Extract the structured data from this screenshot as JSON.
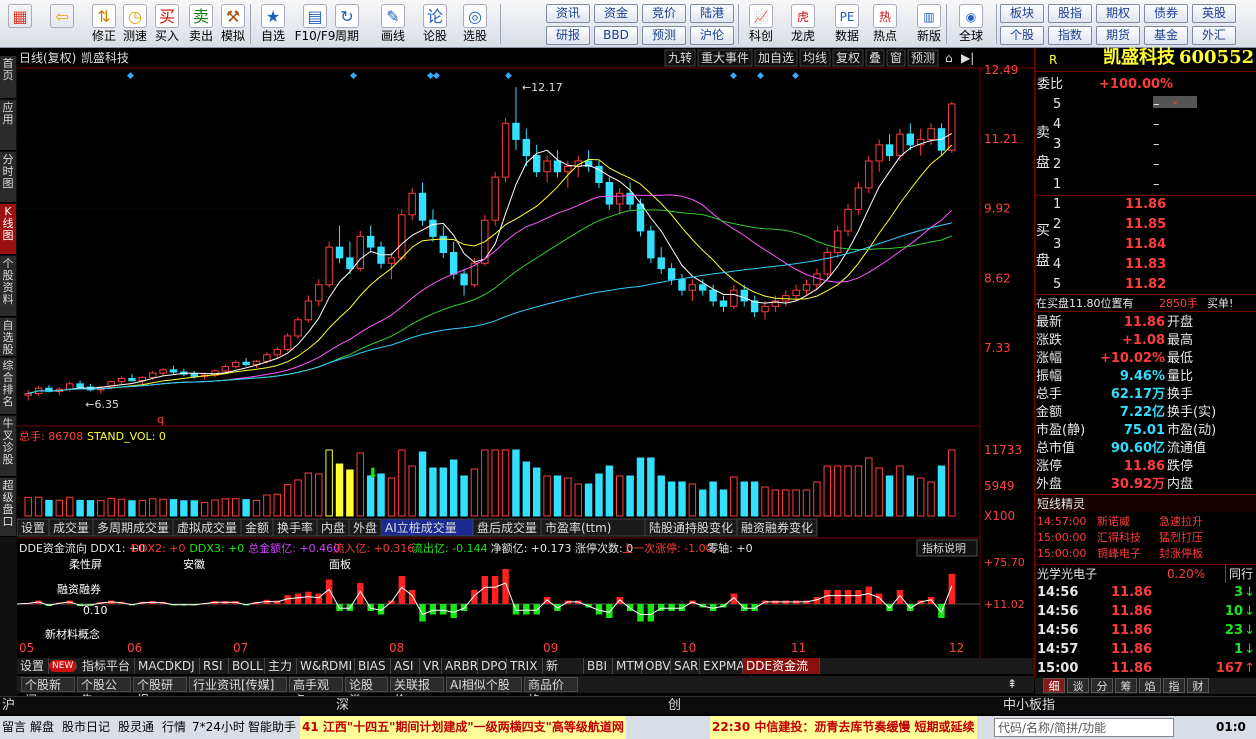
{
  "toolbar": {
    "buttons": [
      {
        "label": "",
        "icon": "windows-icon",
        "glyph": "▦",
        "color": "#e03a2a"
      },
      {
        "label": "",
        "icon": "back-arrow-icon",
        "glyph": "⇦",
        "color": "#f0a000"
      },
      {
        "label": "修正",
        "icon": "up-down-arrow-icon",
        "glyph": "⇅",
        "color": "#d08000"
      },
      {
        "label": "测速",
        "icon": "clock-icon",
        "glyph": "◷",
        "color": "#e0a000"
      },
      {
        "label": "买入",
        "icon": "buy-icon",
        "glyph": "买",
        "color": "#d01010"
      },
      {
        "label": "卖出",
        "icon": "sell-icon",
        "glyph": "卖",
        "color": "#108010"
      },
      {
        "label": "模拟",
        "icon": "hammer-icon",
        "glyph": "⚒",
        "color": "#a05010"
      },
      {
        "label": "自选",
        "icon": "star-folder-icon",
        "glyph": "★",
        "color": "#2060c0"
      },
      {
        "label": "F10/F9",
        "icon": "f10-icon",
        "glyph": "▤",
        "color": "#2060c0"
      },
      {
        "label": "周期",
        "icon": "cycle-icon",
        "glyph": "↻",
        "color": "#2060c0"
      },
      {
        "label": "画线",
        "icon": "pencil-icon",
        "glyph": "✎",
        "color": "#2060c0"
      },
      {
        "label": "论股",
        "icon": "discuss-icon",
        "glyph": "论",
        "color": "#2060c0"
      },
      {
        "label": "选股",
        "icon": "select-stock-icon",
        "glyph": "◎",
        "color": "#2060c0"
      }
    ],
    "grid_left": [
      "资讯",
      "资金",
      "竞价",
      "陆港",
      "研报",
      "BBD",
      "预测",
      "沪伦"
    ],
    "buttons2": [
      {
        "label": "科创",
        "icon": "sci-chart-icon",
        "glyph": "📈",
        "color": "#2060c0"
      },
      {
        "label": "龙虎",
        "icon": "dragon-tiger-icon",
        "glyph": "虎",
        "color": "#d01010"
      },
      {
        "label": "数据",
        "icon": "pe-icon",
        "glyph": "PE",
        "color": "#2060c0"
      },
      {
        "label": "热点",
        "icon": "hot-icon",
        "glyph": "热",
        "color": "#d01010"
      },
      {
        "label": "新版",
        "icon": "new-version-icon",
        "glyph": "▥",
        "color": "#2060c0"
      },
      {
        "label": "全球",
        "icon": "globe-icon",
        "glyph": "◉",
        "color": "#2060c0"
      }
    ],
    "grid_right": [
      "板块",
      "股指",
      "期权",
      "债券",
      "英股",
      "个股",
      "指数",
      "期货",
      "基金",
      "外汇"
    ]
  },
  "left_nav": [
    "首页",
    "应用",
    "分时图",
    "K线图",
    "个股资料",
    "自选股",
    "综合排名",
    "牛叉诊股",
    "超级盘口"
  ],
  "chart_header": {
    "mode": "日线(复权)",
    "name": "凯盛科技",
    "tools": [
      "九转",
      "重大事件",
      "加自选",
      "均线",
      "复权",
      "叠",
      "窗",
      "预测"
    ]
  },
  "chart_data": {
    "type": "candlestick",
    "y_ticks": [
      "12.49",
      "11.21",
      "9.92",
      "8.62",
      "7.33"
    ],
    "high_label": "12.17",
    "low_label": "6.35",
    "x_months": [
      "05",
      "06",
      "07",
      "08",
      "09",
      "10",
      "11",
      "12"
    ],
    "ohlc": [
      [
        6.45,
        6.55,
        6.35,
        6.48
      ],
      [
        6.48,
        6.62,
        6.44,
        6.58
      ],
      [
        6.58,
        6.64,
        6.5,
        6.52
      ],
      [
        6.52,
        6.6,
        6.45,
        6.56
      ],
      [
        6.56,
        6.7,
        6.52,
        6.66
      ],
      [
        6.66,
        6.72,
        6.58,
        6.6
      ],
      [
        6.6,
        6.66,
        6.52,
        6.55
      ],
      [
        6.55,
        6.62,
        6.48,
        6.6
      ],
      [
        6.6,
        6.72,
        6.56,
        6.7
      ],
      [
        6.7,
        6.8,
        6.64,
        6.76
      ],
      [
        6.76,
        6.84,
        6.7,
        6.72
      ],
      [
        6.72,
        6.8,
        6.66,
        6.78
      ],
      [
        6.78,
        6.9,
        6.74,
        6.86
      ],
      [
        6.86,
        6.96,
        6.8,
        6.92
      ],
      [
        6.92,
        7.0,
        6.84,
        6.88
      ],
      [
        6.88,
        6.94,
        6.8,
        6.84
      ],
      [
        6.84,
        6.9,
        6.76,
        6.8
      ],
      [
        6.8,
        6.86,
        6.74,
        6.82
      ],
      [
        6.82,
        6.92,
        6.78,
        6.9
      ],
      [
        6.9,
        7.02,
        6.86,
        6.98
      ],
      [
        6.98,
        7.1,
        6.94,
        7.06
      ],
      [
        7.06,
        7.14,
        6.98,
        7.02
      ],
      [
        7.02,
        7.1,
        6.96,
        7.08
      ],
      [
        7.08,
        7.25,
        7.04,
        7.2
      ],
      [
        7.2,
        7.35,
        7.12,
        7.3
      ],
      [
        7.3,
        7.6,
        7.26,
        7.55
      ],
      [
        7.55,
        7.9,
        7.5,
        7.85
      ],
      [
        7.85,
        8.3,
        7.8,
        8.2
      ],
      [
        8.2,
        8.6,
        8.1,
        8.5
      ],
      [
        8.5,
        9.3,
        8.45,
        9.2
      ],
      [
        9.2,
        9.6,
        8.9,
        9.0
      ],
      [
        9.0,
        9.3,
        8.7,
        8.8
      ],
      [
        8.8,
        9.5,
        8.75,
        9.4
      ],
      [
        9.4,
        9.6,
        9.1,
        9.2
      ],
      [
        9.2,
        9.3,
        8.8,
        8.9
      ],
      [
        8.9,
        9.1,
        8.6,
        9.0
      ],
      [
        9.0,
        9.9,
        8.95,
        9.8
      ],
      [
        9.8,
        10.3,
        9.7,
        10.2
      ],
      [
        10.2,
        10.4,
        9.6,
        9.7
      ],
      [
        9.7,
        9.9,
        9.3,
        9.4
      ],
      [
        9.4,
        9.6,
        9.0,
        9.1
      ],
      [
        9.1,
        9.3,
        8.6,
        8.7
      ],
      [
        8.7,
        8.8,
        8.3,
        8.5
      ],
      [
        8.5,
        9.0,
        8.45,
        8.9
      ],
      [
        8.9,
        9.8,
        8.85,
        9.7
      ],
      [
        9.7,
        10.6,
        9.6,
        10.5
      ],
      [
        10.5,
        11.6,
        10.4,
        11.5
      ],
      [
        11.5,
        12.17,
        11.0,
        11.2
      ],
      [
        11.2,
        11.4,
        10.7,
        10.9
      ],
      [
        10.9,
        11.1,
        10.5,
        10.6
      ],
      [
        10.6,
        10.9,
        10.4,
        10.8
      ],
      [
        10.8,
        11.0,
        10.5,
        10.6
      ],
      [
        10.6,
        10.8,
        10.3,
        10.7
      ],
      [
        10.7,
        10.9,
        10.5,
        10.8
      ],
      [
        10.8,
        11.0,
        10.6,
        10.7
      ],
      [
        10.7,
        10.8,
        10.3,
        10.4
      ],
      [
        10.4,
        10.5,
        9.9,
        10.0
      ],
      [
        10.0,
        10.3,
        9.8,
        10.2
      ],
      [
        10.2,
        10.4,
        9.9,
        10.0
      ],
      [
        10.0,
        10.1,
        9.4,
        9.5
      ],
      [
        9.5,
        9.6,
        8.9,
        9.0
      ],
      [
        9.0,
        9.2,
        8.7,
        8.8
      ],
      [
        8.8,
        8.9,
        8.5,
        8.6
      ],
      [
        8.6,
        8.7,
        8.3,
        8.4
      ],
      [
        8.4,
        8.6,
        8.2,
        8.5
      ],
      [
        8.5,
        8.6,
        8.3,
        8.4
      ],
      [
        8.4,
        8.5,
        8.1,
        8.2
      ],
      [
        8.2,
        8.3,
        8.0,
        8.1
      ],
      [
        8.1,
        8.5,
        8.05,
        8.4
      ],
      [
        8.4,
        8.5,
        8.1,
        8.2
      ],
      [
        8.2,
        8.3,
        7.9,
        8.0
      ],
      [
        8.0,
        8.2,
        7.85,
        8.1
      ],
      [
        8.1,
        8.3,
        8.0,
        8.2
      ],
      [
        8.2,
        8.4,
        8.1,
        8.3
      ],
      [
        8.3,
        8.5,
        8.2,
        8.4
      ],
      [
        8.4,
        8.6,
        8.3,
        8.5
      ],
      [
        8.5,
        8.8,
        8.4,
        8.7
      ],
      [
        8.7,
        9.2,
        8.6,
        9.1
      ],
      [
        9.1,
        9.6,
        9.0,
        9.5
      ],
      [
        9.5,
        10.0,
        9.4,
        9.9
      ],
      [
        9.9,
        10.4,
        9.8,
        10.3
      ],
      [
        10.3,
        10.9,
        10.2,
        10.8
      ],
      [
        10.8,
        11.2,
        10.6,
        11.1
      ],
      [
        11.1,
        11.3,
        10.8,
        10.9
      ],
      [
        10.9,
        11.4,
        10.8,
        11.3
      ],
      [
        11.3,
        11.5,
        11.0,
        11.1
      ],
      [
        11.1,
        11.4,
        10.9,
        11.2
      ],
      [
        11.2,
        11.5,
        11.1,
        11.4
      ],
      [
        11.4,
        11.5,
        10.9,
        11.0
      ],
      [
        11.0,
        11.9,
        10.95,
        11.86
      ]
    ],
    "ma_colors": [
      "#ffffff",
      "#ffff33",
      "#ff55ff",
      "#33cc33",
      "#33ccff"
    ],
    "vol_label": "总手: 86708",
    "vol_series": "STAND_VOL: 0",
    "vol_ticks": [
      "11733",
      "5949",
      "X100"
    ],
    "vol_tabs": [
      "设置",
      "成交量",
      "多周期成交量",
      "虚拟成交量",
      "金额",
      "换手率",
      "内盘",
      "外盘",
      "AI立桩成交量",
      "盘后成交量",
      "市盈率(ttm)",
      "陆股通持股变化",
      "融资融券变化"
    ],
    "dde_header": [
      {
        "t": "DDE资金流向 DDX1: +0",
        "c": "wht"
      },
      {
        "t": "DDX2: +0",
        "c": "red"
      },
      {
        "t": "DDX3: +0",
        "c": "grn"
      },
      {
        "t": "总金额亿: +0.460",
        "c": "#cc44ff"
      },
      {
        "t": "流入亿: +0.316",
        "c": "red"
      },
      {
        "t": "流出亿: -0.144",
        "c": "grn"
      },
      {
        "t": "净额亿: +0.173 涨停次数: 0",
        "c": "wht"
      },
      {
        "t": "上一次涨停: -1.00",
        "c": "red"
      },
      {
        "t": "零轴: +0",
        "c": "wht"
      }
    ],
    "dde_btn": "指标说明",
    "dde_ticks": [
      "+75.70",
      "+11.02"
    ],
    "dde_annotations": [
      "柔性屏",
      "安徽",
      "面板",
      "融资融券",
      "0.10",
      "新材料概念"
    ]
  },
  "right_panel": {
    "title": "凯盛科技",
    "code": "600552",
    "r": "R",
    "weibi_label": "委比",
    "weibi": "+100.00%",
    "sell_label": [
      "卖",
      "盘"
    ],
    "buy_label": [
      "买",
      "盘"
    ],
    "asks": [
      {
        "lv": "5",
        "p": "–"
      },
      {
        "lv": "4",
        "p": "–"
      },
      {
        "lv": "3",
        "p": "–"
      },
      {
        "lv": "2",
        "p": "–"
      },
      {
        "lv": "1",
        "p": "–"
      }
    ],
    "bids": [
      {
        "lv": "1",
        "p": "11.86"
      },
      {
        "lv": "2",
        "p": "11.85"
      },
      {
        "lv": "3",
        "p": "11.84"
      },
      {
        "lv": "4",
        "p": "11.83"
      },
      {
        "lv": "5",
        "p": "11.82"
      }
    ],
    "tip": "在买盘11.80位置有",
    "tip_vol": "2850手",
    "tip_act": "买单!",
    "quotes": [
      [
        "最新",
        "11.86",
        "开盘"
      ],
      [
        "涨跌",
        "+1.08",
        "最高"
      ],
      [
        "涨幅",
        "+10.02%",
        "最低"
      ],
      [
        "振幅",
        "9.46%",
        "量比"
      ],
      [
        "总手",
        "62.17万",
        "换手"
      ],
      [
        "金额",
        "7.22亿",
        "换手(实)"
      ],
      [
        "市盈(静)",
        "75.01",
        "市盈(动)"
      ],
      [
        "总市值",
        "90.60亿",
        "流通值"
      ],
      [
        "涨停",
        "11.86",
        "跌停"
      ],
      [
        "外盘",
        "30.92万",
        "内盘"
      ]
    ],
    "sprite_title": "短线精灵",
    "sprites": [
      [
        "14:57:00",
        "新诺威",
        "急速拉升"
      ],
      [
        "15:00:00",
        "汇得科技",
        "猛烈打压"
      ],
      [
        "15:00:00",
        "铜峰电子",
        "封涨停板"
      ]
    ],
    "sector": "光学光电子",
    "sector_pct": "0.20%",
    "sector_tab": "同行",
    "ticks": [
      [
        "14:56",
        "11.86",
        "3"
      ],
      [
        "14:56",
        "11.86",
        "10"
      ],
      [
        "14:56",
        "11.86",
        "23"
      ],
      [
        "14:57",
        "11.86",
        "1"
      ],
      [
        "15:00",
        "11.86",
        "167"
      ]
    ],
    "bottom_tabs": [
      "细",
      "谈",
      "分",
      "筹",
      "焰",
      "指",
      "财"
    ]
  },
  "ind_tabs": [
    "设置",
    "NEW",
    "指标平台",
    "MACD",
    "KDJ",
    "RSI",
    "BOLL",
    "主力",
    "W&R",
    "DMI",
    "BIAS",
    "ASI",
    "VR",
    "ARBR",
    "DPO",
    "TRIX",
    "新DMA",
    "BBI",
    "MTM",
    "OBV",
    "SAR",
    "EXPMA",
    "DDE资金流向"
  ],
  "news_tabs": [
    "个股新闻",
    "个股公告",
    "个股研报",
    "行业资讯[传媒]",
    "高手观点",
    "论股堂",
    "关联报价",
    "AI相似个股",
    "商品价格"
  ],
  "market_bar": {
    "sh": "沪",
    "sz": "深",
    "cy": "创",
    "zx": "中小板指"
  },
  "status": {
    "items": [
      "留言",
      "解盘",
      "股市日记",
      "股灵通",
      "行情",
      "7*24小时",
      "智能助手"
    ],
    "news1": "41 江西\"十四五\"期间计划建成\"一级两横四支\"高等级航道网",
    "news2": "22:30 中信建投：沥青去库节奏缓慢 短期或延续",
    "search": "代码/名称/简拼/功能",
    "time": "01:0"
  }
}
